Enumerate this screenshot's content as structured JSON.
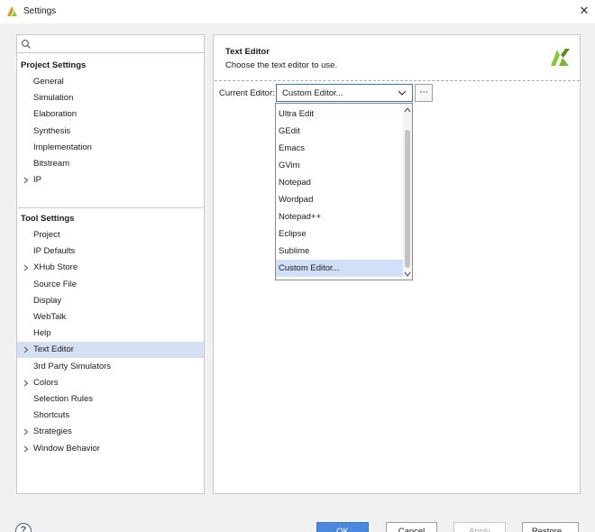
{
  "window": {
    "title": "Settings",
    "close_glyph": "✕"
  },
  "colors": {
    "accent": "#4a88de",
    "selection": "#d5e1f2",
    "brand_green": "#8cc63f"
  },
  "search": {
    "placeholder": "Q-"
  },
  "sidebar": {
    "project_header": "Project Settings",
    "project_items": [
      {
        "label": "General",
        "expandable": false
      },
      {
        "label": "Simulation",
        "expandable": false
      },
      {
        "label": "Elaboration",
        "expandable": false
      },
      {
        "label": "Synthesis",
        "expandable": false
      },
      {
        "label": "Implementation",
        "expandable": false
      },
      {
        "label": "Bitstream",
        "expandable": false
      },
      {
        "label": "IP",
        "expandable": true
      }
    ],
    "tool_header": "Tool Settings",
    "tool_items": [
      {
        "label": "Project",
        "expandable": false
      },
      {
        "label": "IP Defaults",
        "expandable": false
      },
      {
        "label": "XHub Store",
        "expandable": true
      },
      {
        "label": "Source File",
        "expandable": false
      },
      {
        "label": "Display",
        "expandable": false
      },
      {
        "label": "WebTalk",
        "expandable": false
      },
      {
        "label": "Help",
        "expandable": false
      },
      {
        "label": "Text Editor",
        "expandable": true,
        "selected": true
      },
      {
        "label": "3rd Party Simulators",
        "expandable": false
      },
      {
        "label": "Colors",
        "expandable": true
      },
      {
        "label": "Selection Rules",
        "expandable": false
      },
      {
        "label": "Shortcuts",
        "expandable": false
      },
      {
        "label": "Strategies",
        "expandable": true
      },
      {
        "label": "Window Behavior",
        "expandable": true
      }
    ]
  },
  "panel": {
    "title": "Text Editor",
    "subtitle": "Choose the text editor to use.",
    "field_label": "Current Editor:",
    "current_editor": "Custom Editor...",
    "browse_label": "···"
  },
  "dropdown": {
    "options": [
      "Ultra Edit",
      "GEdit",
      "Emacs",
      "GVim",
      "Notepad",
      "Wordpad",
      "Notepad++",
      "Eclipse",
      "Sublime",
      "Custom Editor..."
    ],
    "selected_index": 9
  },
  "buttons": {
    "help": "?",
    "ok": "OK",
    "cancel": "Cancel",
    "apply": "Apply",
    "restore": "Restore..."
  }
}
